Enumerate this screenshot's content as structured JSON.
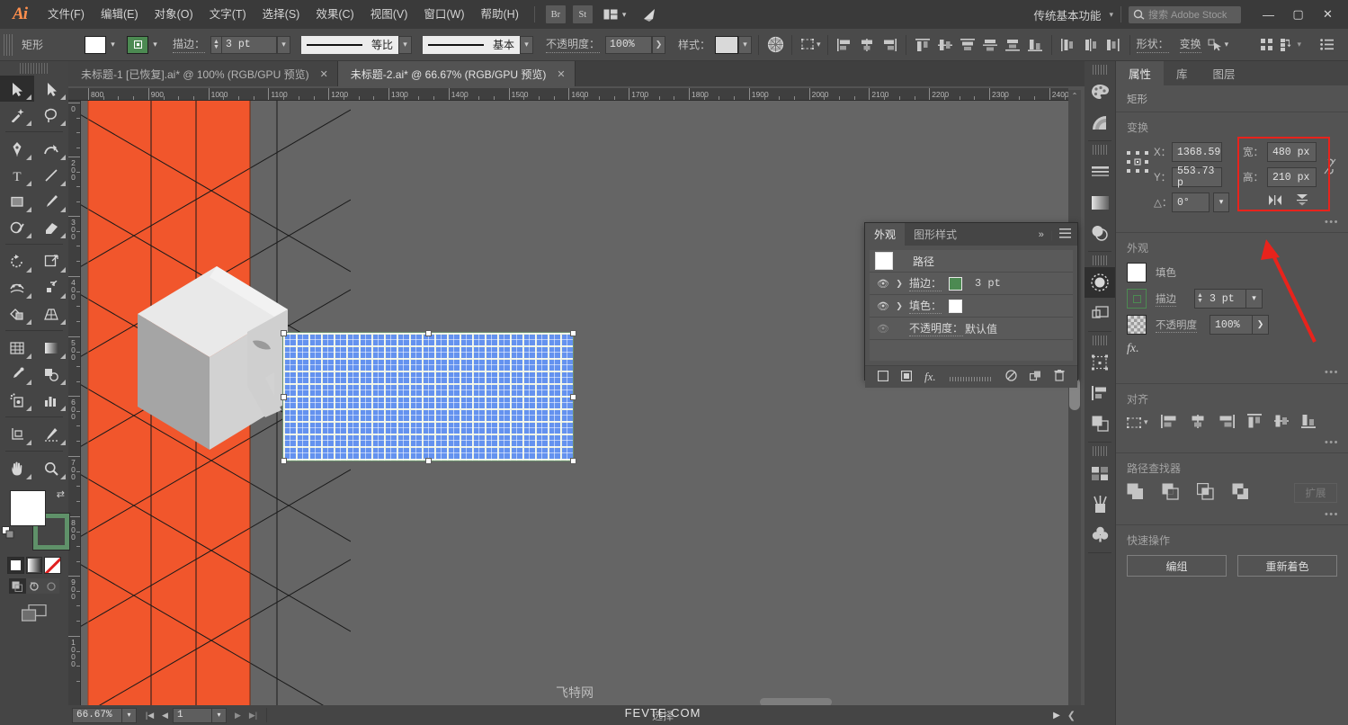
{
  "app": {
    "logo": "Ai",
    "menus": [
      "文件(F)",
      "编辑(E)",
      "对象(O)",
      "文字(T)",
      "选择(S)",
      "效果(C)",
      "视图(V)",
      "窗口(W)",
      "帮助(H)"
    ],
    "bridge_btn": "Br",
    "stock_btn": "St",
    "arrange_icon": "arrange-documents-icon",
    "discover_icon": "discover-icon",
    "workspace": "传统基本功能",
    "search_placeholder": "搜索 Adobe Stock",
    "window_buttons": {
      "minimize": "—",
      "maximize": "▢",
      "close": "✕"
    }
  },
  "control_bar": {
    "object_label": "矩形",
    "fill_color": "#ffffff",
    "stroke_color": "#4c8a52",
    "stroke_label": "描边：",
    "stroke_weight": "3 pt",
    "profile_variable": "等比",
    "profile_brush": "基本",
    "opacity_label": "不透明度：",
    "opacity_value": "100%",
    "style_label": "样式：",
    "shape_label": "形状：",
    "transform_label": "变换",
    "align_icons": [
      "align-left",
      "align-center-h",
      "align-right",
      "align-top",
      "align-middle-v",
      "align-bottom",
      "distribute-top",
      "distribute-middle",
      "distribute-bottom",
      "distribute-h-left",
      "distribute-h-center",
      "distribute-h-right"
    ]
  },
  "tabs": [
    {
      "label": "未标题-1 [已恢复].ai* @ 100% (RGB/GPU 预览)",
      "active": false,
      "close": "✕"
    },
    {
      "label": "未标题-2.ai* @ 66.67% (RGB/GPU 预览)",
      "active": true,
      "close": "✕"
    }
  ],
  "toolbar": {
    "tools": [
      {
        "name": "selection-tool",
        "glyph": "selection",
        "selected": true
      },
      {
        "name": "direct-selection-tool",
        "glyph": "direct-selection",
        "selected": false
      },
      {
        "name": "magic-wand-tool",
        "glyph": "magic-wand",
        "selected": false
      },
      {
        "name": "lasso-tool",
        "glyph": "lasso",
        "selected": false
      },
      {
        "name": "pen-tool",
        "glyph": "pen",
        "selected": false
      },
      {
        "name": "curvature-tool",
        "glyph": "curvature",
        "selected": false
      },
      {
        "name": "type-tool",
        "glyph": "type",
        "selected": false
      },
      {
        "name": "line-segment-tool",
        "glyph": "line",
        "selected": false
      },
      {
        "name": "rectangle-tool",
        "glyph": "rectangle",
        "selected": false
      },
      {
        "name": "paintbrush-tool",
        "glyph": "paintbrush",
        "selected": false
      },
      {
        "name": "shaper-tool",
        "glyph": "shaper",
        "selected": false
      },
      {
        "name": "eraser-tool",
        "glyph": "eraser",
        "selected": false
      },
      {
        "name": "rotate-tool",
        "glyph": "rotate",
        "selected": false
      },
      {
        "name": "scale-tool",
        "glyph": "scale",
        "selected": false
      },
      {
        "name": "width-tool",
        "glyph": "width",
        "selected": false
      },
      {
        "name": "free-transform-tool",
        "glyph": "free-transform",
        "selected": false
      },
      {
        "name": "shape-builder-tool",
        "glyph": "shape-builder",
        "selected": false
      },
      {
        "name": "perspective-grid-tool",
        "glyph": "perspective-grid",
        "selected": false
      },
      {
        "name": "mesh-tool",
        "glyph": "mesh",
        "selected": false
      },
      {
        "name": "gradient-tool",
        "glyph": "gradient",
        "selected": false
      },
      {
        "name": "eyedropper-tool",
        "glyph": "eyedropper",
        "selected": false
      },
      {
        "name": "blend-tool",
        "glyph": "blend",
        "selected": false
      },
      {
        "name": "symbol-sprayer-tool",
        "glyph": "symbol-sprayer",
        "selected": false
      },
      {
        "name": "column-graph-tool",
        "glyph": "column-graph",
        "selected": false
      },
      {
        "name": "artboard-tool",
        "glyph": "artboard",
        "selected": false
      },
      {
        "name": "slice-tool",
        "glyph": "slice",
        "selected": false
      },
      {
        "name": "hand-tool",
        "glyph": "hand",
        "selected": false
      },
      {
        "name": "zoom-tool",
        "glyph": "zoom",
        "selected": false
      }
    ],
    "fill_color": "#ffffff",
    "stroke_color": "#5f9169",
    "color_modes": [
      "color-swatch",
      "gradient-swatch",
      "none-swatch"
    ],
    "draw_modes": [
      "draw-normal",
      "draw-behind",
      "draw-inside"
    ],
    "screen_mode": "change-screen-mode"
  },
  "rulers": {
    "horizontal": [
      "800",
      "900",
      "1000",
      "1100",
      "1200",
      "1300",
      "1400",
      "1500",
      "1600",
      "1700",
      "1800",
      "1900",
      "2000",
      "2100",
      "2200",
      "2300",
      "2400"
    ],
    "vertical": [
      "0",
      "200",
      "300",
      "400",
      "500",
      "600",
      "700",
      "800",
      "900",
      "1000"
    ],
    "unit": "px"
  },
  "canvas": {
    "watermark_cn": "飞特网",
    "watermark_en": "FEVTE.COM",
    "artwork": {
      "strip_color": "#f1562c",
      "letter": "R",
      "letter_color": "#e2e2e2"
    },
    "selection": {
      "fill_pattern": "grid-pattern",
      "pattern_color": "#6492ef",
      "stroke_color": "#6b8f6f"
    }
  },
  "appearance_panel": {
    "tabs": [
      {
        "label": "外观",
        "active": true
      },
      {
        "label": "图形样式",
        "active": false
      }
    ],
    "collapse_icon": "double-chevron-right-icon",
    "menu_icon": "panel-menu-icon",
    "rows": [
      {
        "name": "path-row",
        "label": "路径",
        "swatch": "#ffffff",
        "value": ""
      },
      {
        "name": "stroke-row",
        "label": "描边：",
        "swatch": "#4c8a52",
        "value": "3 pt"
      },
      {
        "name": "fill-row",
        "label": "填色：",
        "swatch": "#ffffff",
        "value": ""
      },
      {
        "name": "opacity-row",
        "label": "不透明度：",
        "swatch": "",
        "value": "默认值"
      }
    ],
    "footer_icons": [
      "add-new-stroke-icon",
      "add-new-fill-icon",
      "add-effect-icon",
      "clear-appearance-icon",
      "duplicate-item-icon",
      "delete-item-icon"
    ]
  },
  "properties": {
    "tabs": [
      {
        "label": "属性",
        "active": true
      },
      {
        "label": "库",
        "active": false
      },
      {
        "label": "图层",
        "active": false
      }
    ],
    "object_type": "矩形",
    "transform": {
      "title": "变换",
      "reference_point": "reference-point-grid",
      "x_label": "X：",
      "x_value": "1368.59",
      "y_label": "Y：",
      "y_value": "553.73 p",
      "w_label": "宽：",
      "w_value": "480 px",
      "h_label": "高：",
      "h_value": "210 px",
      "angle_label": "△：",
      "angle_value": "0°",
      "link_icon": "unlink-proportions-icon",
      "flip_h_icon": "flip-horizontal-icon",
      "flip_v_icon": "flip-vertical-icon",
      "more_options": "•••",
      "highlight_color": "#e8231c"
    },
    "appearance": {
      "title": "外观",
      "fill_label": "填色",
      "fill_color": "#ffffff",
      "stroke_label": "描边",
      "stroke_color": "#4c8a52",
      "stroke_weight": "3 pt",
      "opacity_label": "不透明度",
      "opacity_value": "100%",
      "fx_label": "fx.",
      "more_options": "•••"
    },
    "align": {
      "title": "对齐",
      "icons": [
        "align-to-selection",
        "align-left",
        "align-center-h",
        "align-right",
        "align-top",
        "align-middle-v",
        "align-bottom"
      ],
      "more_options": "•••"
    },
    "pathfinder": {
      "title": "路径查找器",
      "icons": [
        "unite-icon",
        "minus-front-icon",
        "intersect-icon",
        "exclude-icon"
      ],
      "expand_label": "扩展",
      "more_options": "•••"
    },
    "quick_actions": {
      "title": "快速操作",
      "buttons": [
        "编组",
        "重新着色"
      ]
    }
  },
  "dock_icons": [
    "color-icon",
    "color-guide-icon",
    "stroke-icon",
    "gradient-icon",
    "transparency-icon",
    "brushes-icon",
    "symbols-icon",
    "artboards-icon",
    "align-panel-icon",
    "pathfinder-panel-icon",
    "swatches-icon",
    "brush-libraries-icon",
    "symbol-libraries-icon"
  ],
  "status_bar": {
    "zoom_value": "66.67%",
    "artboard_number": "1",
    "status_text": "选择",
    "nav_first": "|◀",
    "nav_prev": "◀",
    "nav_next": "▶",
    "nav_last": "▶|"
  }
}
